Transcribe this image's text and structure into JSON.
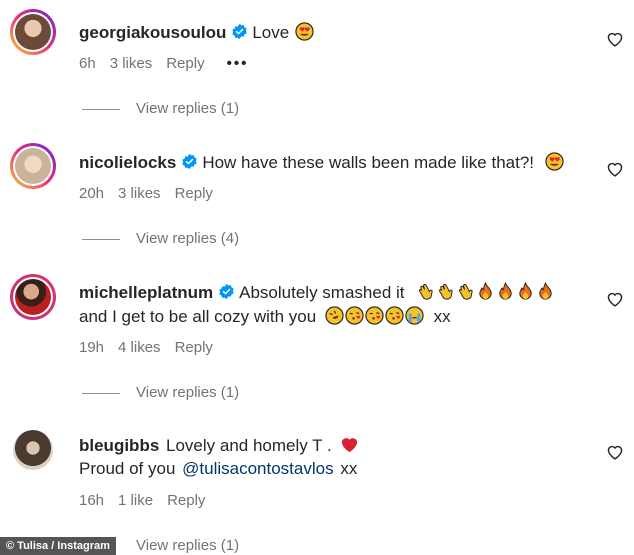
{
  "comments": [
    {
      "username": "georgiakousoulou",
      "verified": true,
      "text_line1": "Love",
      "text_line2": "",
      "time": "6h",
      "likes": "3 likes",
      "reply": "Reply",
      "more": "•••",
      "view_replies": "View replies (1)",
      "emojis_line1": [
        "heart-eyes"
      ],
      "avatar_color": "#6b4a3a"
    },
    {
      "username": "nicolielocks",
      "verified": true,
      "text_line1": "How have these walls been made like that?!",
      "text_line2": "",
      "time": "20h",
      "likes": "3 likes",
      "reply": "Reply",
      "view_replies": "View replies (4)",
      "emojis_line1": [
        "heart-eyes"
      ],
      "avatar_color": "#c9b49a"
    },
    {
      "username": "michelleplatnum",
      "verified": true,
      "text_line1": "Absolutely smashed it",
      "text_line2": "and I get to be all cozy with you",
      "text_line2_suffix": "xx",
      "time": "19h",
      "likes": "4 likes",
      "reply": "Reply",
      "view_replies": "View replies (1)",
      "emojis_line1": [
        "clap",
        "clap",
        "clap",
        "fire",
        "fire",
        "fire",
        "fire"
      ],
      "emojis_line2": [
        "rofl",
        "kiss",
        "kiss",
        "kiss",
        "sob"
      ],
      "avatar_color": "#8a2a22"
    },
    {
      "username": "bleugibbs",
      "verified": false,
      "text_line1": "Lovely and homely T .",
      "text_line2_prefix": "Proud of you",
      "mention": "@tulisacontostavlos",
      "text_line2_suffix": "xx",
      "time": "16h",
      "likes": "1 like",
      "reply": "Reply",
      "view_replies": "View replies (1)",
      "emojis_line1": [
        "red-heart"
      ],
      "avatar_color": "#4a3a30"
    }
  ],
  "credit": "© Tulisa / Instagram",
  "colors": {
    "verified_blue": "#0095f6",
    "story_ring": "#c13584",
    "muted": "#737373",
    "mention": "#00376b"
  }
}
